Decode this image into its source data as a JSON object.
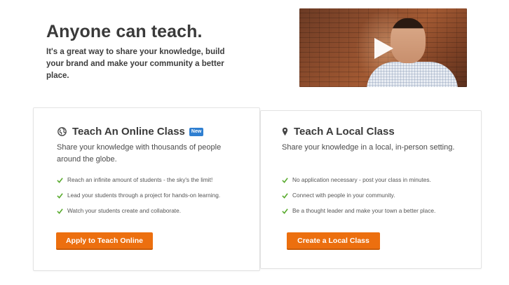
{
  "hero": {
    "title": "Anyone can teach.",
    "subtitle": "It's a great way to share your knowledge, build your brand and make your community a better place."
  },
  "video": {
    "icon": "play-icon"
  },
  "online": {
    "icon": "globe-icon",
    "title": "Teach An Online Class",
    "badge": "New",
    "description": "Share your knowledge with thousands of people around the globe.",
    "features": [
      "Reach an infinite amount of students - the sky's the limit!",
      "Lead your students through a project for hands-on learning.",
      "Watch your students create and collaborate."
    ],
    "cta": "Apply to Teach Online"
  },
  "local": {
    "icon": "map-pin-icon",
    "title": "Teach A Local Class",
    "description": "Share your knowledge in a local, in-person setting.",
    "features": [
      "No application necessary - post your class in minutes.",
      "Connect with people in your community.",
      "Be a thought leader and make your town a better place."
    ],
    "cta": "Create a Local Class"
  },
  "colors": {
    "accent": "#ec6f0f",
    "badge": "#2f7fd1",
    "check": "#5aab2f"
  }
}
